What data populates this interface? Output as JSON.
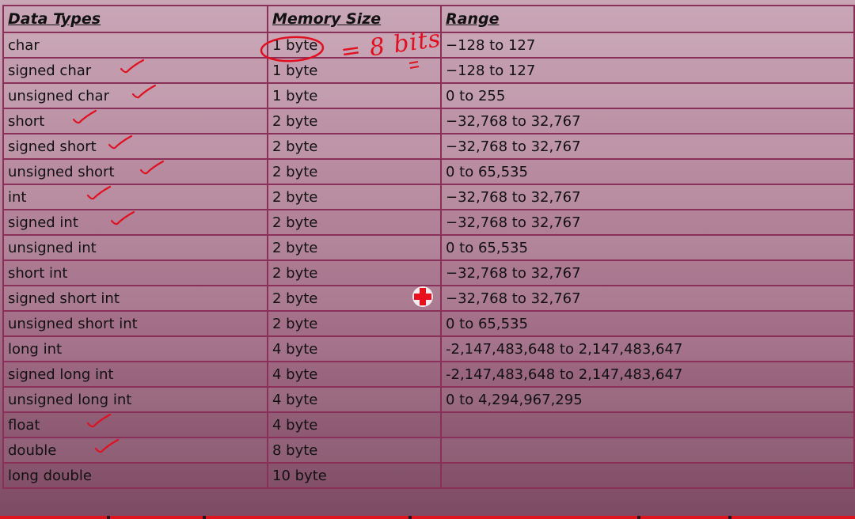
{
  "table": {
    "headers": [
      "Data Types",
      "Memory Size",
      "Range"
    ],
    "rows": [
      {
        "type": "char",
        "size": "1 byte",
        "range": "−128 to 127",
        "checked": false,
        "circled": true
      },
      {
        "type": "signed char",
        "size": "1 byte",
        "range": "−128 to 127",
        "checked": true
      },
      {
        "type": "unsigned char",
        "size": "1 byte",
        "range": "0 to 255",
        "checked": true
      },
      {
        "type": "short",
        "size": "2 byte",
        "range": "−32,768 to 32,767",
        "checked": true
      },
      {
        "type": "signed short",
        "size": "2 byte",
        "range": "−32,768 to 32,767",
        "checked": true
      },
      {
        "type": "unsigned short",
        "size": "2 byte",
        "range": "0 to 65,535",
        "checked": true
      },
      {
        "type": "int",
        "size": "2 byte",
        "range": "−32,768 to 32,767",
        "checked": true
      },
      {
        "type": "signed int",
        "size": "2 byte",
        "range": "−32,768 to 32,767",
        "checked": true
      },
      {
        "type": "unsigned int",
        "size": "2 byte",
        "range": "0 to 65,535",
        "checked": false
      },
      {
        "type": "short int",
        "size": "2 byte",
        "range": "−32,768 to 32,767",
        "checked": false
      },
      {
        "type": "signed short int",
        "size": "2 byte",
        "range": "−32,768 to 32,767",
        "checked": false
      },
      {
        "type": "unsigned short int",
        "size": "2 byte",
        "range": "0 to 65,535",
        "checked": false
      },
      {
        "type": "long int",
        "size": "4 byte",
        "range": "-2,147,483,648 to 2,147,483,647",
        "checked": false
      },
      {
        "type": "signed long int",
        "size": "4 byte",
        "range": "-2,147,483,648 to 2,147,483,647",
        "checked": false
      },
      {
        "type": "unsigned long int",
        "size": "4 byte",
        "range": "0 to 4,294,967,295",
        "checked": false
      },
      {
        "type": "float",
        "size": "4 byte",
        "range": "",
        "checked": true
      },
      {
        "type": "double",
        "size": "8 byte",
        "range": "",
        "checked": true
      },
      {
        "type": "long double",
        "size": "10 byte",
        "range": "",
        "checked": false
      }
    ]
  },
  "annotation": {
    "handwritten_note": "= 8 bits",
    "ink_color": "#e01020"
  },
  "colors": {
    "grid_line": "#8a2f58",
    "highlight_red": "#e0141e"
  }
}
